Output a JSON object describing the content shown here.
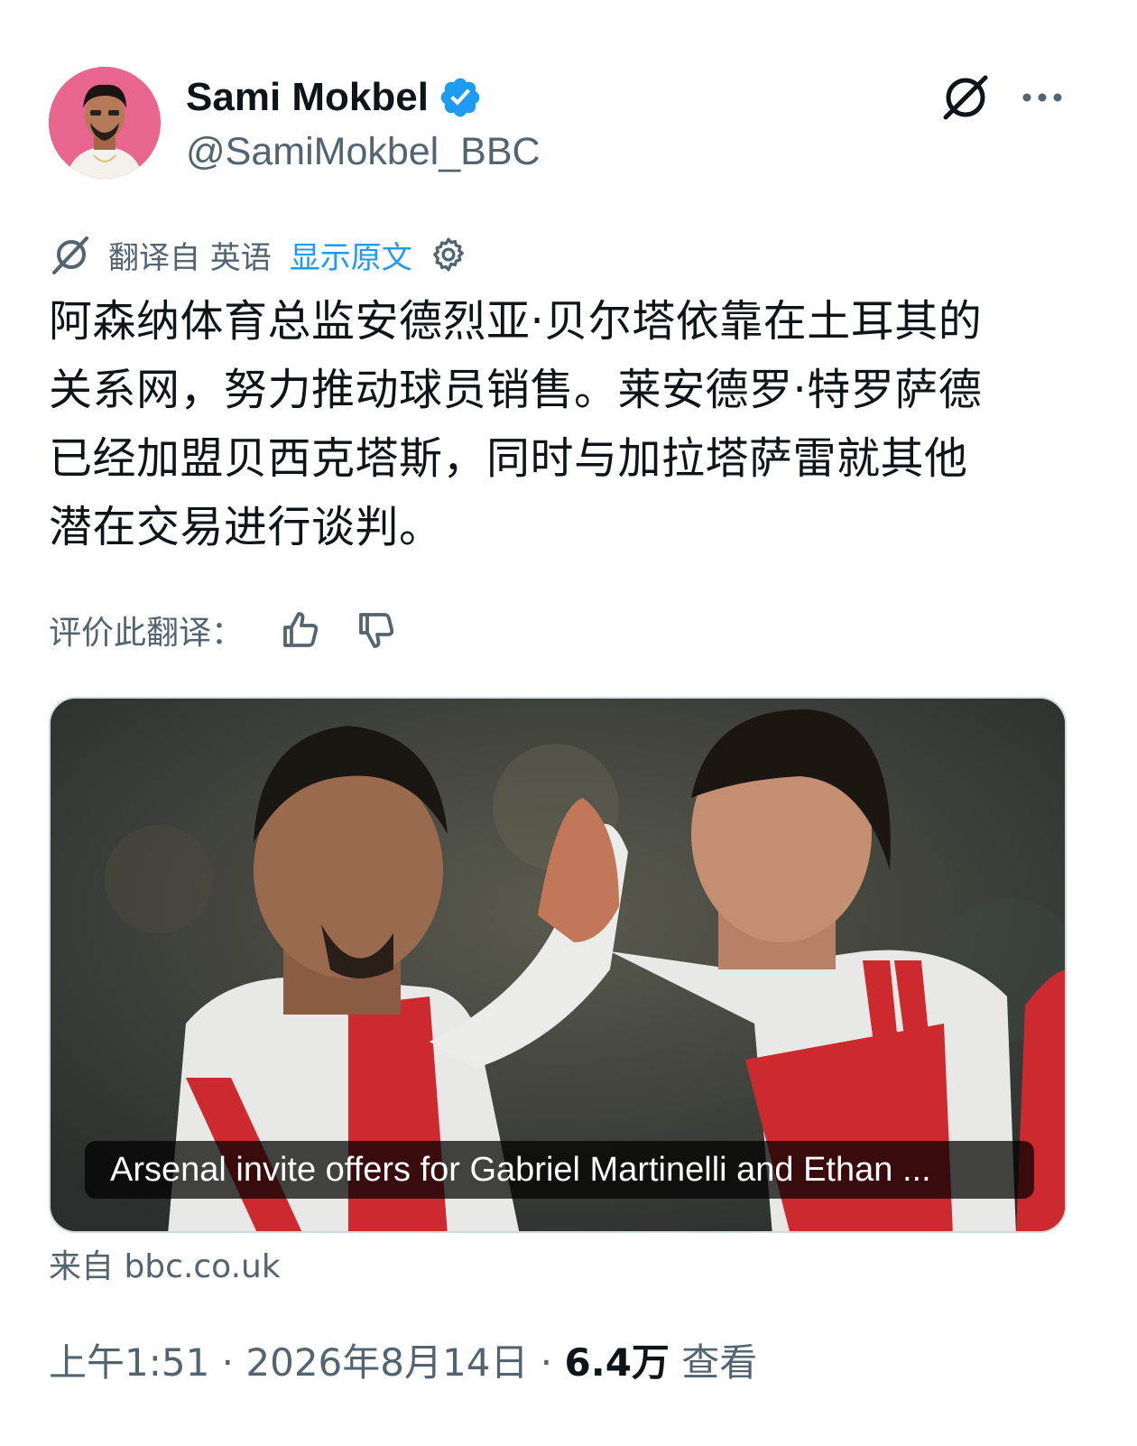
{
  "author": {
    "display_name": "Sami Mokbel",
    "handle": "@SamiMokbel_BBC",
    "verified": true,
    "avatar_bg": "#e8668e"
  },
  "header_icons": {
    "grok": "grok-icon",
    "more": "more-icon"
  },
  "translation": {
    "from_label": "翻译自 英语",
    "show_original": "显示原文",
    "icon": "translate-icon",
    "settings_icon": "gear-icon"
  },
  "tweet": {
    "lines": [
      "阿森纳体育总监安德烈亚·贝尔塔依靠在土耳其的",
      "关系网，努力推动球员销售。莱安德罗·特罗萨德",
      "已经加盟贝西克塔斯，同时与加拉塔萨雷就其他",
      "潜在交易进行谈判。"
    ]
  },
  "rating": {
    "label": "评价此翻译：",
    "up_icon": "thumbs-up-icon",
    "down_icon": "thumbs-down-icon"
  },
  "link_card": {
    "caption": "Arsenal invite offers for Gabriel Martinelli and Ethan ...",
    "source": "来自 bbc.co.uk"
  },
  "meta": {
    "time": "上午1:51",
    "sep1": " · ",
    "date": "2026年8月14日",
    "sep2": " · ",
    "views": "6.4万",
    "views_label": " 查看"
  },
  "colors": {
    "accent": "#1d9bf0",
    "secondary_text": "#536471",
    "primary_text": "#0f1419"
  }
}
